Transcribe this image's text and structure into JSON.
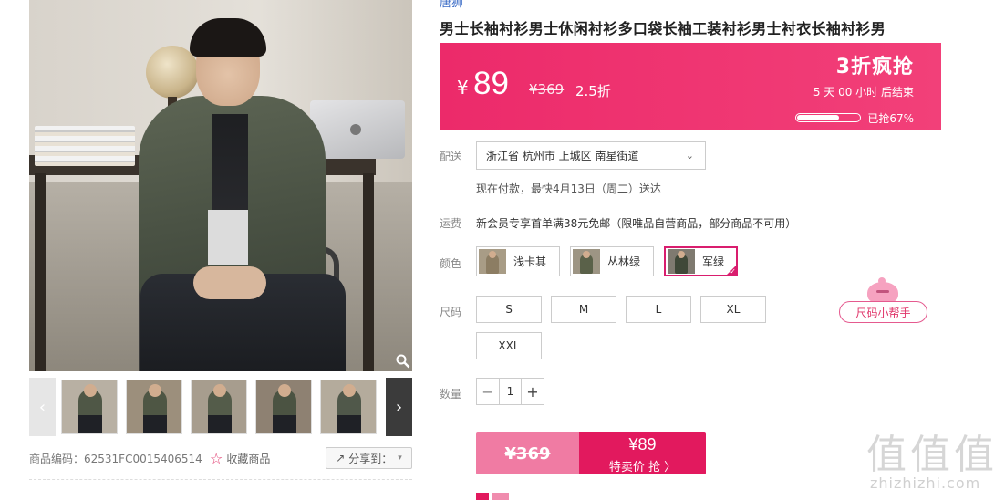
{
  "gallery": {
    "zoom_icon": "magnifier-icon",
    "prev_icon": "‹",
    "next_icon": "›",
    "thumbnails": [
      {
        "bg": "#b8b0a3",
        "body": "#4f5746"
      },
      {
        "bg": "#9c8f7c",
        "body": "#4e5644"
      },
      {
        "bg": "#a79d8e",
        "body": "#545c4a"
      },
      {
        "bg": "#8e8172",
        "body": "#4b5342"
      },
      {
        "bg": "#b4ab9c",
        "body": "#50584a"
      }
    ]
  },
  "meta": {
    "sku": "商品编码：62531FC0015406514",
    "favorite_label": "收藏商品",
    "favorite_icon": "☆",
    "share_label": "分享到：",
    "share_icon": "↗",
    "share_caret": "▾"
  },
  "brand": "唐狮",
  "title": "男士长袖衬衫男士休闲衬衫多口袋长袖工装衬衫男士衬衣长袖衬衫男",
  "price_panel": {
    "currency": "¥",
    "price": "89",
    "original_price": "¥369",
    "discount": "2.5折",
    "promo_title": "3折疯抢",
    "countdown": "5 天 00 小时 后结束",
    "progress_text": "已抢67%",
    "progress_fraction": 0.67,
    "bg_color": "#ec2a6a"
  },
  "delivery": {
    "label": "配送",
    "address": "浙江省 杭州市 上城区 南星街道",
    "caret": "⌄",
    "note": "现在付款，最快4月13日（周二）送达"
  },
  "shipping": {
    "label": "运费",
    "note": "新会员专享首单满38元免邮（限唯品自营商品，部分商品不可用）"
  },
  "colors": {
    "label": "颜色",
    "options": [
      {
        "name": "浅卡其",
        "swatch_bg": "#a89c86",
        "swatch_body": "#8c7d63",
        "selected": false
      },
      {
        "name": "丛林绿",
        "swatch_bg": "#9d9584",
        "swatch_body": "#5a6149",
        "selected": false
      },
      {
        "name": "军绿",
        "swatch_bg": "#7f7a70",
        "swatch_body": "#3f4838",
        "selected": true
      }
    ],
    "check_mark": "✓"
  },
  "sizes": {
    "label": "尺码",
    "options": [
      "S",
      "M",
      "L",
      "XL",
      "XXL"
    ],
    "helper_label": "尺码小帮手"
  },
  "quantity": {
    "label": "数量",
    "value": "1",
    "minus": "−",
    "plus": "+"
  },
  "buy": {
    "original_price": "¥369",
    "price": "¥89",
    "action_label": "特卖价 抢 〉",
    "accent_color": "#e2195e"
  },
  "watermark": {
    "glyphs": "值值值",
    "url": "zhizhizhi.com"
  }
}
